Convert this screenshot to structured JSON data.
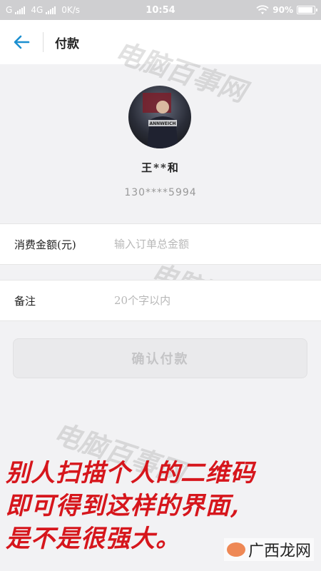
{
  "status_bar": {
    "carrier_left": "G",
    "network": "4G",
    "speed": "0K/s",
    "time": "10:54",
    "battery": "90%",
    "battery_level": 0.9
  },
  "header": {
    "back_icon": "arrow-left-icon",
    "title": "付款"
  },
  "profile": {
    "avatar_text": "ANNWEICH",
    "name": "王**和",
    "phone": "130****5994"
  },
  "form": {
    "amount_label": "消费金额(元)",
    "amount_placeholder": "输入订单总金额",
    "note_label": "备注",
    "note_placeholder": "20个字以内",
    "confirm_label": "确认付款"
  },
  "watermarks": [
    "电脑百事网",
    "电脑百事网",
    "电脑百事网"
  ],
  "caption": {
    "line1": "别人扫描个人的二维码",
    "line2": "即可得到这样的界面,",
    "line3": "是不是很强大。"
  },
  "corner_brand": "广西龙网",
  "colors": {
    "accent": "#1b8fd0",
    "caption_red": "#d6161c"
  }
}
